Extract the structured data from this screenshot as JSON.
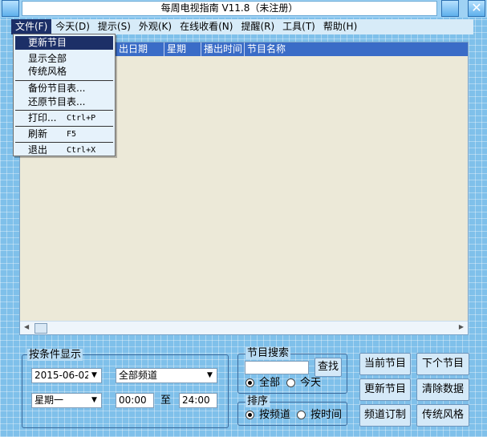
{
  "window": {
    "title": "每周电视指南 V11.8（未注册）",
    "close_glyph": "✕"
  },
  "menubar": {
    "items": [
      "文件(F)",
      "今天(D)",
      "提示(S)",
      "外观(K)",
      "在线收看(N)",
      "提醒(R)",
      "工具(T)",
      "帮助(H)"
    ]
  },
  "file_menu": {
    "items": [
      {
        "label": "更新节目",
        "shortcut": ""
      },
      {
        "label": "显示全部",
        "shortcut": ""
      },
      {
        "label": "传统风格",
        "shortcut": ""
      },
      {
        "label": "备份节目表...",
        "shortcut": ""
      },
      {
        "label": "还原节目表...",
        "shortcut": ""
      },
      {
        "label": "打印...",
        "shortcut": "Ctrl+P"
      },
      {
        "label": "刷新",
        "shortcut": "F5"
      },
      {
        "label": "退出",
        "shortcut": "Ctrl+X"
      }
    ]
  },
  "list": {
    "columns": [
      "出日期",
      "星期",
      "播出时间",
      "节目名称"
    ]
  },
  "condition": {
    "title": "按条件显示",
    "date": "2015-06-02",
    "channel": "全部频道",
    "weekday": "星期一",
    "time_from": "00:00",
    "to_label": "至",
    "time_to": "24:00"
  },
  "search": {
    "title": "节目搜索",
    "query": "",
    "find_button": "查找",
    "options": [
      "全部",
      "今天"
    ],
    "selected": "全部"
  },
  "sort": {
    "title": "排序",
    "options": [
      "按频道",
      "按时间"
    ],
    "selected": "按频道"
  },
  "actions": {
    "current": "当前节目",
    "next": "下个节目",
    "update": "更新节目",
    "clear": "清除数据",
    "subscribe": "频道订制",
    "classic": "传统风格"
  }
}
